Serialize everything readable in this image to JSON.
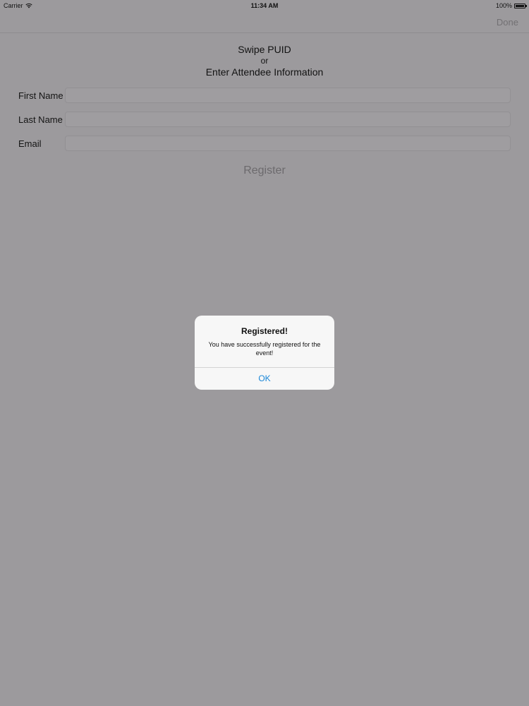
{
  "status_bar": {
    "carrier": "Carrier",
    "time": "11:34 AM",
    "battery_percent": "100%",
    "battery_level": 1.0
  },
  "nav": {
    "done_label": "Done"
  },
  "heading": {
    "line1": "Swipe PUID",
    "line2": "or",
    "line3": "Enter Attendee Information"
  },
  "form": {
    "first_name_label": "First Name",
    "first_name_value": "",
    "last_name_label": "Last Name",
    "last_name_value": "",
    "email_label": "Email",
    "email_value": ""
  },
  "register_label": "Register",
  "alert": {
    "title": "Registered!",
    "message": "You have successfully registered for the event!",
    "ok_label": "OK"
  },
  "colors": {
    "dimmed_background": "#9c9a9d",
    "alert_background": "#f7f7f7",
    "alert_button": "#1a87d8"
  }
}
